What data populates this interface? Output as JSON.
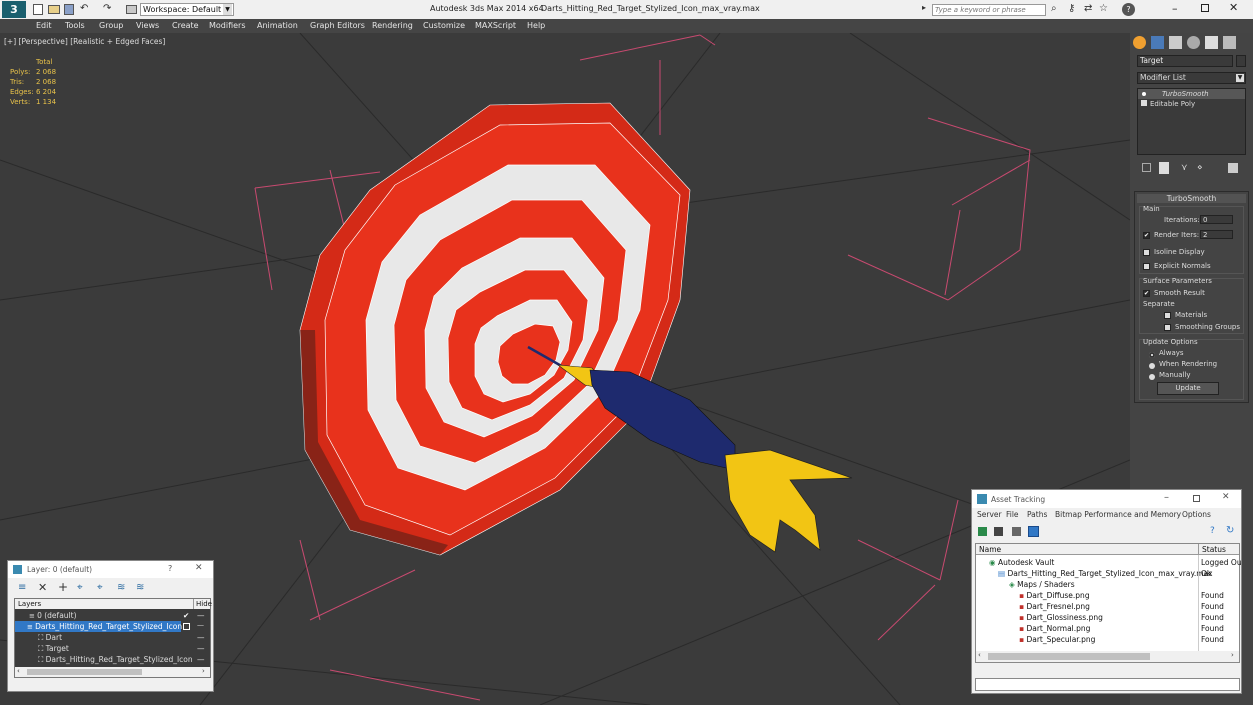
{
  "title_bar": {
    "workspace_label": "Workspace: Default",
    "app_title": "Autodesk 3ds Max 2014 x64",
    "file_title": "Darts_Hitting_Red_Target_Stylized_Icon_max_vray.max",
    "search_placeholder": "Type a keyword or phrase"
  },
  "menu": {
    "items": [
      "Edit",
      "Tools",
      "Group",
      "Views",
      "Create",
      "Modifiers",
      "Animation",
      "Graph Editors",
      "Rendering",
      "Customize",
      "MAXScript",
      "Help"
    ]
  },
  "viewport": {
    "label": "[+] [Perspective] [Realistic + Edged Faces]",
    "stats": {
      "header": "Total",
      "rows": [
        {
          "label": "Polys:",
          "value": "2 068"
        },
        {
          "label": "Tris:",
          "value": "2 068"
        },
        {
          "label": "Edges:",
          "value": "6 204"
        },
        {
          "label": "Verts:",
          "value": "1 134"
        }
      ]
    }
  },
  "command_panel": {
    "object_name": "Target",
    "modifier_list": "Modifier List",
    "stack": [
      "TurboSmooth",
      "Editable Poly"
    ],
    "rollout_title": "TurboSmooth",
    "main_label": "Main",
    "iterations_label": "Iterations:",
    "iterations_value": "0",
    "render_iters_label": "Render Iters:",
    "render_iters_value": "2",
    "isoline_label": "Isoline Display",
    "explicit_label": "Explicit Normals",
    "surface_label": "Surface Parameters",
    "smooth_result_label": "Smooth Result",
    "separate_label": "Separate",
    "materials_label": "Materials",
    "smoothing_groups_label": "Smoothing Groups",
    "update_options_label": "Update Options",
    "always_label": "Always",
    "when_rendering_label": "When Rendering",
    "manually_label": "Manually",
    "update_button": "Update"
  },
  "layer_window": {
    "title": "Layer: 0 (default)",
    "help": "?",
    "col_layers": "Layers",
    "col_hide": "Hide",
    "rows": [
      {
        "label": "0 (default)",
        "indent": 1
      },
      {
        "label": "Darts_Hitting_Red_Target_Stylized_Icon",
        "indent": 1
      },
      {
        "label": "Dart",
        "indent": 2
      },
      {
        "label": "Target",
        "indent": 2
      },
      {
        "label": "Darts_Hitting_Red_Target_Stylized_Icon",
        "indent": 2
      }
    ]
  },
  "asset_window": {
    "title": "Asset Tracking",
    "menu": [
      "Server",
      "File",
      "Paths",
      "Bitmap Performance and Memory",
      "Options"
    ],
    "col_name": "Name",
    "col_status": "Status",
    "rows": [
      {
        "name": "Autodesk Vault",
        "status": "Logged Ou",
        "indent": 1
      },
      {
        "name": "Darts_Hitting_Red_Target_Stylized_Icon_max_vray.max",
        "status": "Ok",
        "indent": 2
      },
      {
        "name": "Maps / Shaders",
        "status": "",
        "indent": 3
      },
      {
        "name": "Dart_Diffuse.png",
        "status": "Found",
        "indent": 4
      },
      {
        "name": "Dart_Fresnel.png",
        "status": "Found",
        "indent": 4
      },
      {
        "name": "Dart_Glossiness.png",
        "status": "Found",
        "indent": 4
      },
      {
        "name": "Dart_Normal.png",
        "status": "Found",
        "indent": 4
      },
      {
        "name": "Dart_Specular.png",
        "status": "Found",
        "indent": 4
      }
    ]
  },
  "colors": {
    "target_red": "#e8321c",
    "target_white": "#e8e8e8",
    "dart_blue": "#1e2a6e",
    "dart_yellow": "#f2c514",
    "selection_blue": "#3178c6",
    "helper_pink": "#c84a70"
  }
}
